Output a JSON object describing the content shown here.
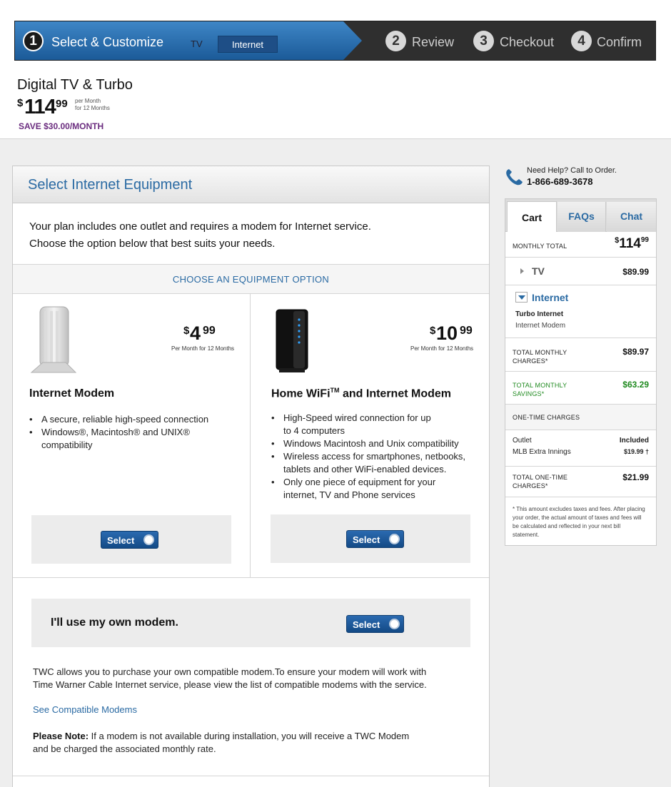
{
  "progress": {
    "steps": [
      {
        "num": "1",
        "label": "Select & Customize"
      },
      {
        "num": "2",
        "label": "Review"
      },
      {
        "num": "3",
        "label": "Checkout"
      },
      {
        "num": "4",
        "label": "Confirm"
      }
    ],
    "subtabs": {
      "tv": "TV",
      "internet": "Internet"
    }
  },
  "plan": {
    "name": "Digital TV & Turbo",
    "currency": "$",
    "dollars": "114",
    "cents": "99",
    "term_line1": "per Month",
    "term_line2": "for 12 Months",
    "save": "SAVE $30.00/MONTH"
  },
  "panel": {
    "title": "Select Internet Equipment",
    "intro_line1": "Your plan includes one outlet and requires a modem for Internet service.",
    "intro_line2": "Choose the option below that best suits your needs.",
    "choose_label": "CHOOSE AN EQUIPMENT OPTION",
    "options": [
      {
        "currency": "$",
        "dollars": "4",
        "cents": "99",
        "term": "Per Month for 12 Months",
        "title": "Internet Modem",
        "bullets": [
          "A secure, reliable high-speed connection",
          "Windows®, Macintosh® and UNIX®",
          "compatibility"
        ],
        "select_label": "Select"
      },
      {
        "currency": "$",
        "dollars": "10",
        "cents": "99",
        "term": "Per Month for 12 Months",
        "title_a": "Home WiFi",
        "title_tm": "TM",
        "title_b": " and Internet Modem",
        "bullets": [
          "High-Speed wired connection for up",
          "to 4 computers",
          "Windows Macintosh and Unix compatibility",
          "Wireless access for smartphones, netbooks,",
          "tablets and other WiFi-enabled devices.",
          "Only one piece of equipment for your",
          "internet, TV and Phone services"
        ],
        "select_label": "Select"
      }
    ],
    "own_modem": {
      "title": "I'll use my own modem.",
      "select_label": "Select",
      "text_line1": "TWC allows you to purchase your own compatible modem.To ensure your modem will work with",
      "text_line2": "Time Warner Cable Internet service, please view the list of compatible modems with the service.",
      "link": "See Compatible Modems",
      "note_label": "Please Note:",
      "note_line1": " If a modem is not available during installation, you will receive a TWC Modem",
      "note_line2": "and be charged the associated monthly rate."
    }
  },
  "help": {
    "question": "Need Help? Call to Order.",
    "phone": "1-866-689-3678"
  },
  "cart": {
    "tabs": {
      "cart": "Cart",
      "faqs": "FAQs",
      "chat": "Chat"
    },
    "monthly_total_label": "MONTHLY TOTAL",
    "monthly_total": {
      "currency": "$",
      "dollars": "114",
      "cents": "99"
    },
    "tv": {
      "label": "TV",
      "price": "$89.99"
    },
    "internet": {
      "label": "Internet",
      "item1": "Turbo Internet",
      "item2": "Internet Modem"
    },
    "total_monthly_charges_l1": "TOTAL MONTHLY",
    "total_monthly_charges_l2": "CHARGES*",
    "total_monthly_charges": "$89.97",
    "total_monthly_savings_l1": "TOTAL MONTHLY",
    "total_monthly_savings_l2": "SAVINGS*",
    "total_monthly_savings": "$63.29",
    "one_time_label": "ONE-TIME CHARGES",
    "outlet_label": "Outlet",
    "outlet_value": "Included",
    "mlb_label": "MLB Extra Innings",
    "mlb_value": "$19.99 †",
    "total_one_time_l1": "TOTAL ONE-TIME",
    "total_one_time_l2": "CHARGES*",
    "total_one_time": "$21.99",
    "footnote": "* This amount excludes taxes and fees. After placing your order, the actual amount of taxes and fees will be calculated and reflected in your next bill statement."
  },
  "colors": {
    "accent_blue": "#2a6aa3",
    "savings_purple": "#6b2d7f",
    "savings_green": "#1f8a1f",
    "progress_active": "#1b5a98"
  }
}
